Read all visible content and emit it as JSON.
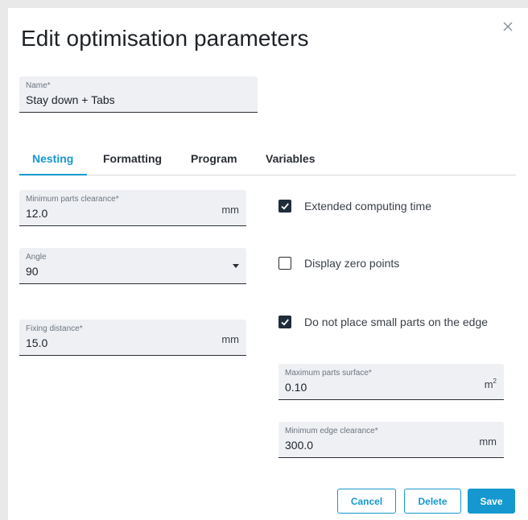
{
  "dialog": {
    "title": "Edit optimisation parameters"
  },
  "name_field": {
    "label": "Name*",
    "value": "Stay down + Tabs"
  },
  "tabs": [
    {
      "label": "Nesting",
      "active": true
    },
    {
      "label": "Formatting",
      "active": false
    },
    {
      "label": "Program",
      "active": false
    },
    {
      "label": "Variables",
      "active": false
    }
  ],
  "nesting": {
    "min_parts_clearance": {
      "label": "Minimum parts clearance*",
      "value": "12.0",
      "unit": "mm"
    },
    "angle": {
      "label": "Angle",
      "value": "90"
    },
    "fixing_distance": {
      "label": "Fixing distance*",
      "value": "15.0",
      "unit": "mm"
    },
    "extended_computing_time": {
      "label": "Extended computing time",
      "checked": true
    },
    "display_zero_points": {
      "label": "Display zero points",
      "checked": false
    },
    "no_small_parts_edge": {
      "label": "Do not place small parts on the edge",
      "checked": true
    },
    "max_parts_surface": {
      "label": "Maximum parts surface*",
      "value": "0.10",
      "unit": "m",
      "unit_sup": "2"
    },
    "min_edge_clearance": {
      "label": "Minimum edge clearance*",
      "value": "300.0",
      "unit": "mm"
    }
  },
  "buttons": {
    "cancel": "Cancel",
    "delete": "Delete",
    "save": "Save"
  },
  "colors": {
    "accent": "#1598cf",
    "checkbox_fill": "#1f2c3a",
    "field_bg": "#eef0f3"
  }
}
